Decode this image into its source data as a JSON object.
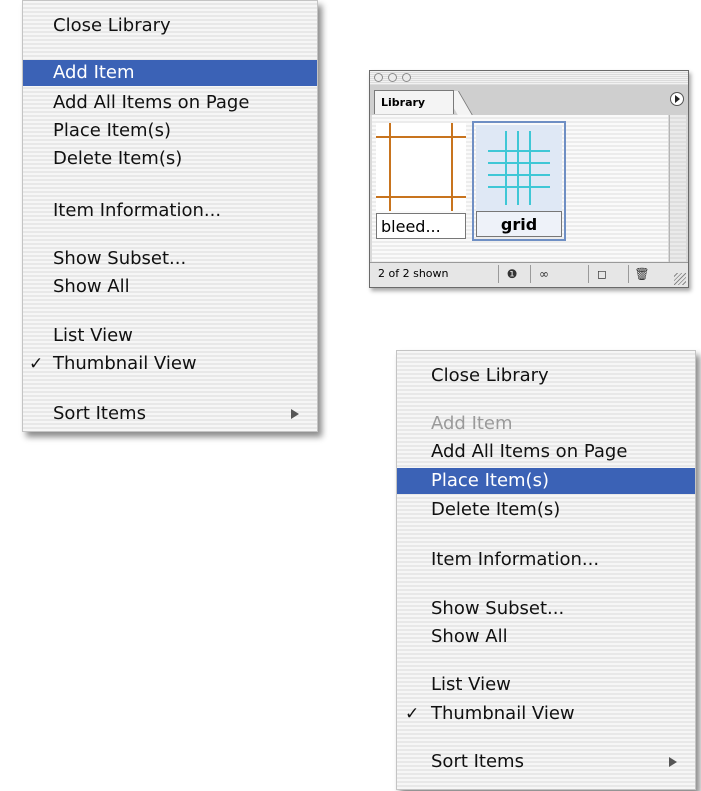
{
  "menu_1": {
    "items": [
      {
        "label": "Close Library"
      },
      {
        "label": "Add Item",
        "state": "highlighted"
      },
      {
        "label": "Add All Items on Page"
      },
      {
        "label": "Place Item(s)"
      },
      {
        "label": "Delete Item(s)"
      },
      {
        "label": "Item Information..."
      },
      {
        "label": "Show Subset..."
      },
      {
        "label": "Show All"
      },
      {
        "label": "List View"
      },
      {
        "label": "Thumbnail View",
        "checked": true
      },
      {
        "label": "Sort Items",
        "submenu": true
      }
    ],
    "check_mark": "✓"
  },
  "menu_2": {
    "items": [
      {
        "label": "Close Library"
      },
      {
        "label": "Add Item",
        "state": "disabled"
      },
      {
        "label": "Add All Items on Page"
      },
      {
        "label": "Place Item(s)",
        "state": "highlighted"
      },
      {
        "label": "Delete Item(s)"
      },
      {
        "label": "Item Information..."
      },
      {
        "label": "Show Subset..."
      },
      {
        "label": "Show All"
      },
      {
        "label": "List View"
      },
      {
        "label": "Thumbnail View",
        "checked": true
      },
      {
        "label": "Sort Items",
        "submenu": true
      }
    ],
    "check_mark": "✓"
  },
  "library_palette": {
    "tab_label": "Library",
    "items": [
      {
        "label": "bleed...",
        "thumbnail_icon": "bleed-frame-icon"
      },
      {
        "label": "grid",
        "thumbnail_icon": "grid-icon",
        "selected": true
      }
    ],
    "status_text": "2 of 2 shown",
    "buttons": [
      {
        "icon": "info-icon",
        "glyph": "❶"
      },
      {
        "icon": "binoculars-icon",
        "glyph": "∞"
      },
      {
        "icon": "new-item-icon",
        "glyph": "◻"
      },
      {
        "icon": "trash-icon",
        "glyph": "🗑"
      }
    ]
  },
  "colors": {
    "highlight": "#3b62b6",
    "bleed_lines": "#c8741e",
    "grid_lines": "#3fc7d6",
    "disabled_text": "#9a9a9a"
  }
}
